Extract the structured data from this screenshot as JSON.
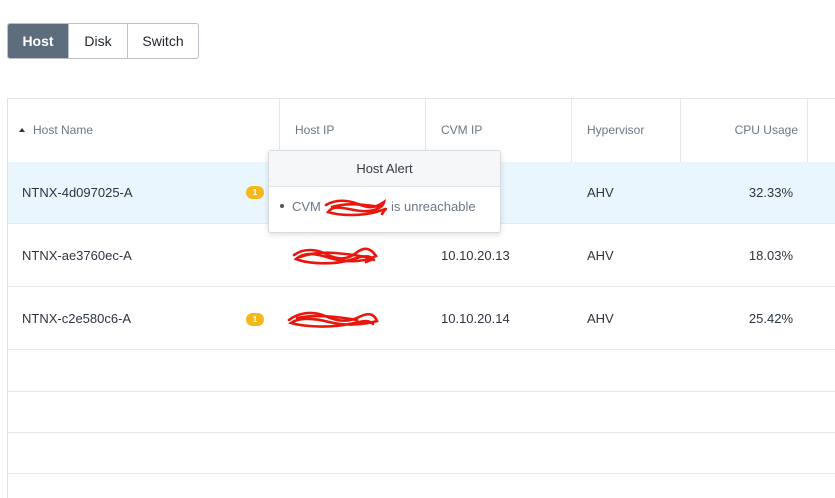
{
  "tabs": [
    {
      "label": "Host",
      "active": true
    },
    {
      "label": "Disk",
      "active": false
    },
    {
      "label": "Switch",
      "active": false
    }
  ],
  "table": {
    "columns": [
      "Host Name",
      "Host IP",
      "CVM IP",
      "Hypervisor",
      "CPU Usage"
    ],
    "sorted_column": "Host Name",
    "rows": [
      {
        "host_name": "NTNX-4d097025-A",
        "alert_count": "1",
        "host_ip": "",
        "cvm_ip": "",
        "hypervisor": "AHV",
        "cpu_usage": "32.33%"
      },
      {
        "host_name": "NTNX-ae3760ec-A",
        "alert_count": "",
        "host_ip": "",
        "cvm_ip": "10.10.20.13",
        "hypervisor": "AHV",
        "cpu_usage": "18.03%"
      },
      {
        "host_name": "NTNX-c2e580c6-A",
        "alert_count": "1",
        "host_ip": "",
        "cvm_ip": "10.10.20.14",
        "hypervisor": "AHV",
        "cpu_usage": "25.42%"
      }
    ]
  },
  "popover": {
    "title": "Host Alert",
    "alert_prefix": "CVM",
    "alert_suffix": "is unreachable"
  },
  "colors": {
    "active_tab": "#5e6d7e",
    "row_highlight": "#eaf6fd",
    "badge": "#f3b81c",
    "redaction": "#e8160c"
  }
}
